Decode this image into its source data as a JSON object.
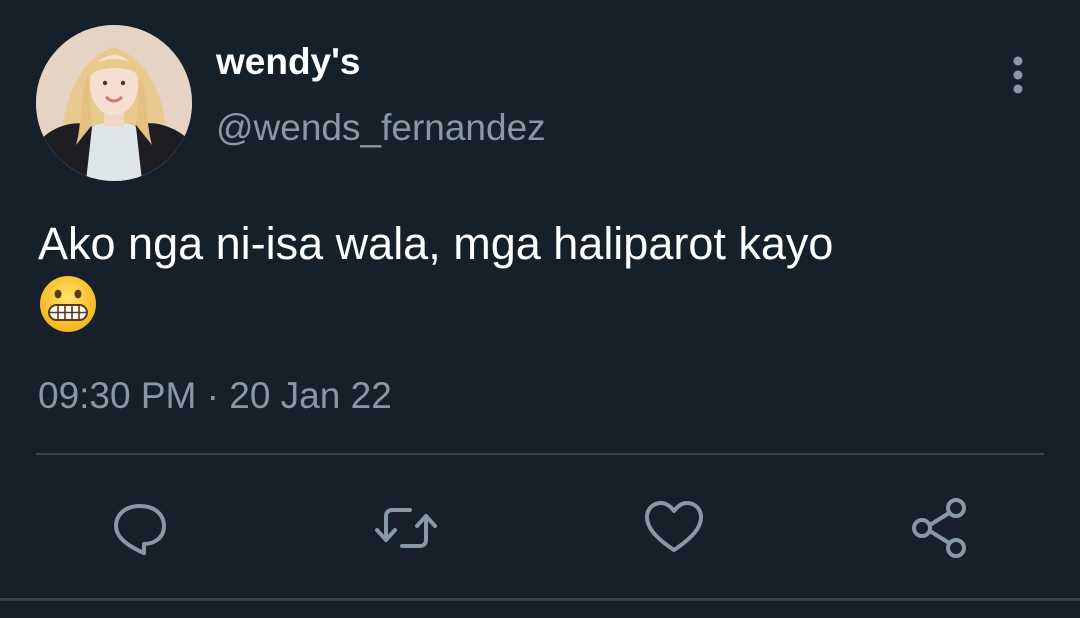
{
  "tweet": {
    "display_name": "wendy's",
    "handle": "@wends_fernandez",
    "text": "Ako nga ni-isa wala, mga haliparot kayo",
    "emoji": "grimacing-face",
    "timestamp": "09:30 PM · 20 Jan 22"
  },
  "icons": {
    "more": "vertical-ellipsis-icon",
    "reply": "reply-bubble-icon",
    "retweet": "retweet-arrows-icon",
    "like": "heart-icon",
    "share": "share-nodes-icon"
  },
  "colors": {
    "background": "#15202b",
    "primary_text": "#ffffff",
    "secondary_text": "#8899a6",
    "divider": "#38444d"
  }
}
